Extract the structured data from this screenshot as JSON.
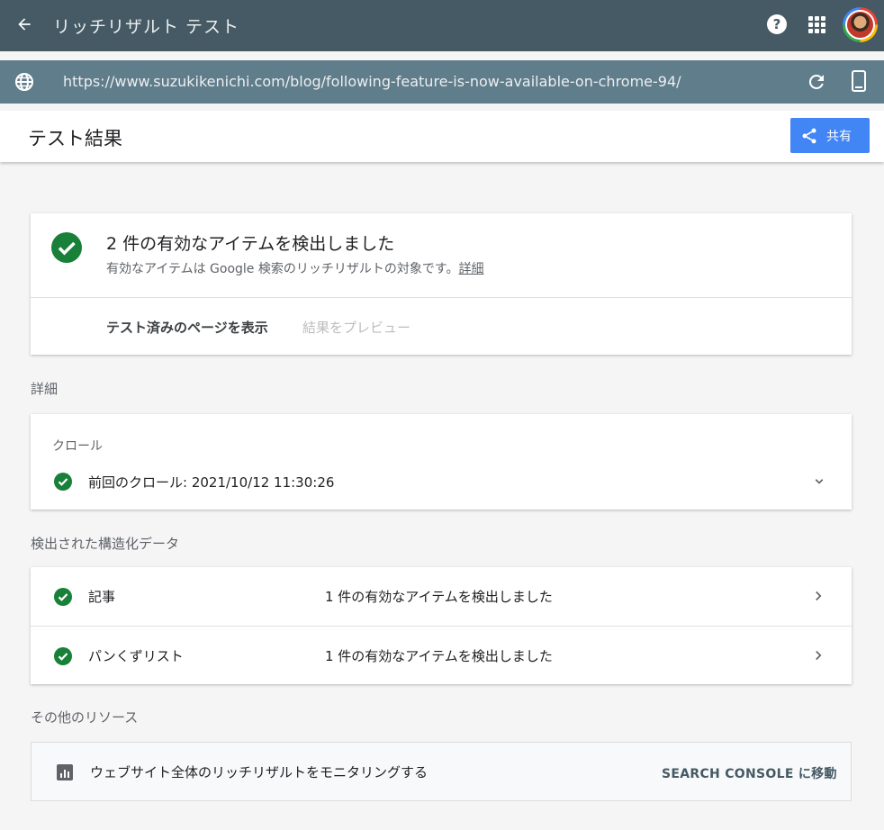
{
  "appbar": {
    "title": "リッチリザルト テスト",
    "help_glyph": "?"
  },
  "urlbar": {
    "url": "https://www.suzukikenichi.com/blog/following-feature-is-now-available-on-chrome-94/"
  },
  "result_header": {
    "title": "テスト結果",
    "share_label": "共有"
  },
  "summary": {
    "headline": "2 件の有効なアイテムを検出しました",
    "subtext": "有効なアイテムは Google 検索のリッチリザルトの対象です。",
    "details_link": "詳細",
    "view_tested_page": "テスト済みのページを表示",
    "preview_results": "結果をプレビュー"
  },
  "details": {
    "section_label": "詳細",
    "crawl_caption": "クロール",
    "last_crawl": "前回のクロール: 2021/10/12 11:30:26"
  },
  "structured_data": {
    "section_label": "検出された構造化データ",
    "items": [
      {
        "name": "記事",
        "count_text": "1 件の有効なアイテムを検出しました"
      },
      {
        "name": "パンくずリスト",
        "count_text": "1 件の有効なアイテムを検出しました"
      }
    ]
  },
  "resources": {
    "section_label": "その他のリソース",
    "monitor_text": "ウェブサイト全体のリッチリザルトをモニタリングする",
    "search_console_link": "SEARCH CONSOLE に移動"
  },
  "colors": {
    "appbar": "#455a64",
    "urlbar": "#607d8b",
    "accent": "#4285f4",
    "success": "#188038"
  }
}
